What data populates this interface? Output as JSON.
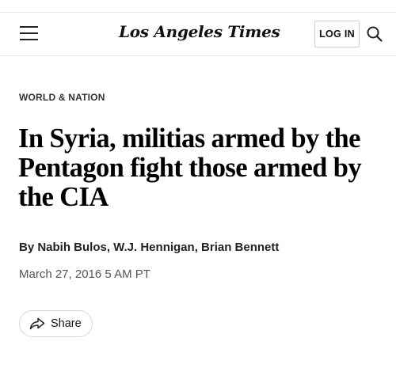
{
  "header": {
    "masthead": "Los Angeles Times",
    "login_label": "LOG IN",
    "menu_icon": "hamburger-menu-icon",
    "search_icon": "search-icon"
  },
  "article": {
    "section": "WORLD & NATION",
    "headline": "In Syria, militias armed by the Pentagon fight those armed by the CIA",
    "byline": "By Nabih Bulos, W.J. Hennigan, Brian Bennett",
    "date": "March 27, 2016 5 AM PT",
    "share_label": "Share",
    "share_icon": "share-arrow-icon"
  }
}
